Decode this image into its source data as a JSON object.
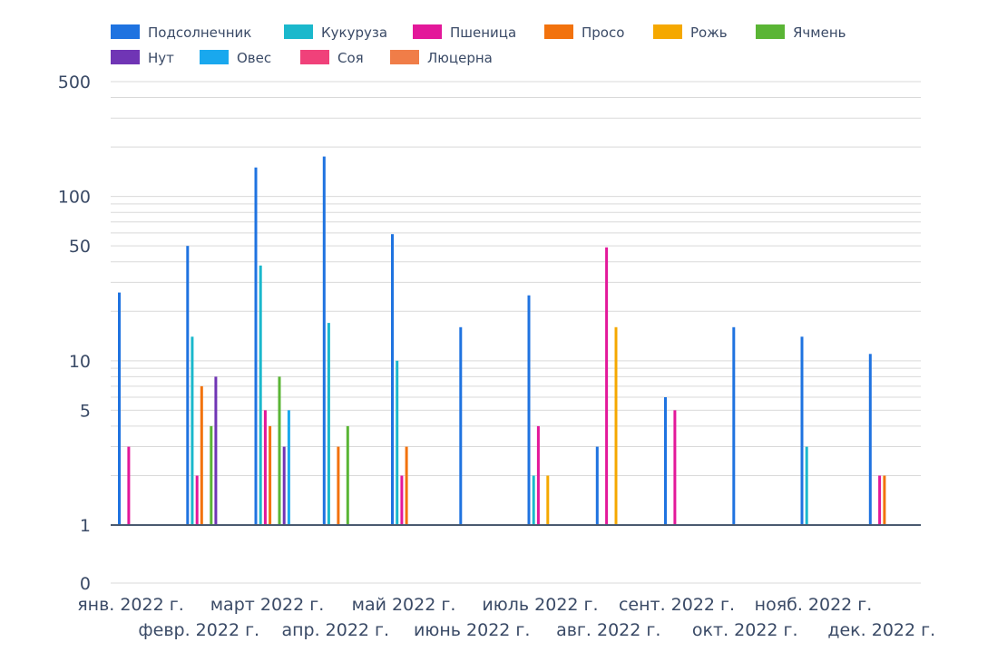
{
  "chart_data": {
    "type": "bar",
    "title": "",
    "xlabel": "",
    "ylabel": "",
    "yscale": "log",
    "ylim": [
      1,
      500
    ],
    "grid": true,
    "legend_position": "top",
    "y_ticks": [
      {
        "label": "500",
        "value": 500
      },
      {
        "label": "100",
        "value": 100
      },
      {
        "label": "50",
        "value": 50
      },
      {
        "label": "10",
        "value": 10
      },
      {
        "label": "5",
        "value": 5
      },
      {
        "label": "1",
        "value": 1
      },
      {
        "label": "0",
        "value": 0
      }
    ],
    "categories": [
      "янв. 2022 г.",
      "февр. 2022 г.",
      "март 2022 г.",
      "апр. 2022 г.",
      "май 2022 г.",
      "июнь 2022 г.",
      "июль 2022 г.",
      "авг. 2022 г.",
      "сент. 2022 г.",
      "окт. 2022 г.",
      "нояб. 2022 г.",
      "дек. 2022 г."
    ],
    "series": [
      {
        "name": "Подсолнечник",
        "color": "#1f73e0",
        "values": [
          26,
          50,
          150,
          175,
          59,
          16,
          25,
          3,
          6,
          16,
          14,
          11
        ]
      },
      {
        "name": "Кукуруза",
        "color": "#1bb8cc",
        "values": [
          null,
          14,
          38,
          17,
          10,
          null,
          2,
          null,
          null,
          null,
          3,
          null
        ]
      },
      {
        "name": "Пшеница",
        "color": "#e3189a",
        "values": [
          3,
          2,
          5,
          null,
          2,
          null,
          4,
          49,
          5,
          null,
          null,
          2
        ]
      },
      {
        "name": "Просо",
        "color": "#f2720d",
        "values": [
          null,
          7,
          4,
          3,
          3,
          null,
          null,
          null,
          null,
          null,
          null,
          2
        ]
      },
      {
        "name": "Рожь",
        "color": "#f5a800",
        "values": [
          null,
          null,
          null,
          null,
          null,
          null,
          2,
          16,
          null,
          null,
          null,
          null
        ]
      },
      {
        "name": "Ячмень",
        "color": "#5ab535",
        "values": [
          null,
          4,
          8,
          4,
          null,
          null,
          null,
          null,
          null,
          null,
          null,
          null
        ]
      },
      {
        "name": "Нут",
        "color": "#7035b5",
        "values": [
          null,
          8,
          3,
          null,
          null,
          null,
          null,
          null,
          null,
          null,
          null,
          null
        ]
      },
      {
        "name": "Овес",
        "color": "#19a8ee",
        "values": [
          null,
          null,
          5,
          null,
          null,
          null,
          null,
          null,
          null,
          null,
          null,
          null
        ]
      },
      {
        "name": "Соя",
        "color": "#f0417a",
        "values": [
          null,
          null,
          null,
          null,
          null,
          null,
          null,
          null,
          null,
          null,
          null,
          null
        ]
      },
      {
        "name": "Люцерна",
        "color": "#f07d48",
        "values": [
          null,
          null,
          null,
          null,
          null,
          null,
          null,
          null,
          null,
          null,
          null,
          null
        ]
      }
    ]
  }
}
